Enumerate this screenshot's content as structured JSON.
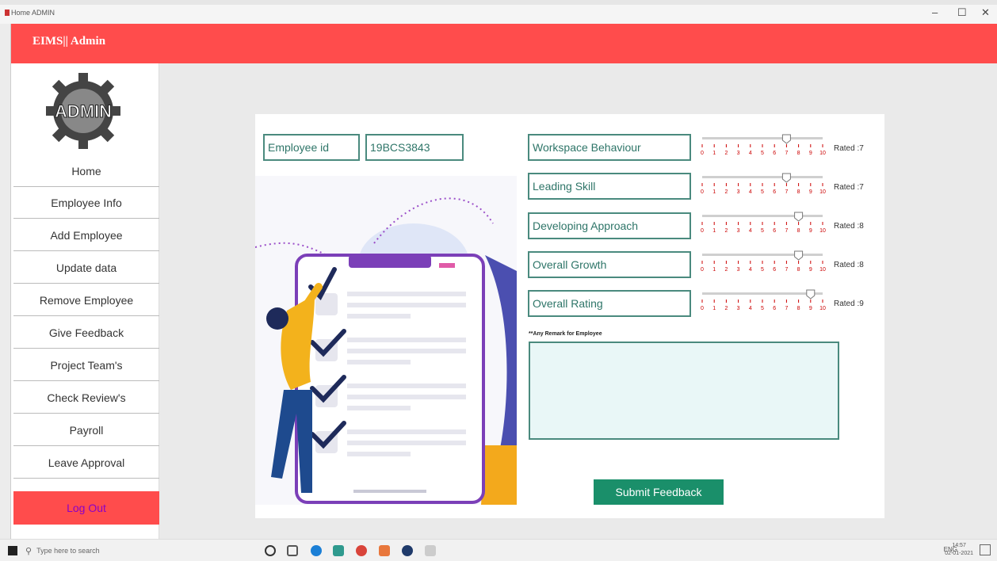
{
  "window": {
    "title": "Home ADMIN",
    "minimize": "–",
    "maximize": "☐",
    "close": "✕"
  },
  "header": {
    "brand": "EIMS|| Admin"
  },
  "sidebar": {
    "logo_text": "ADMIN",
    "items": [
      {
        "label": "Home"
      },
      {
        "label": "Employee Info"
      },
      {
        "label": "Add Employee"
      },
      {
        "label": "Update data"
      },
      {
        "label": "Remove Employee"
      },
      {
        "label": "Give Feedback"
      },
      {
        "label": "Project Team's"
      },
      {
        "label": "Check Review's"
      },
      {
        "label": "Payroll"
      },
      {
        "label": "Leave Approval"
      }
    ],
    "logout": "Log Out"
  },
  "form": {
    "employee_id_label": "Employee id",
    "employee_id_value": "19BCS3843",
    "ratings": [
      {
        "label": "Workspace Behaviour",
        "value": 7,
        "rated": "Rated :7"
      },
      {
        "label": "Leading Skill",
        "value": 7,
        "rated": "Rated :7"
      },
      {
        "label": "Developing Approach",
        "value": 8,
        "rated": "Rated :8"
      },
      {
        "label": "Overall Growth",
        "value": 8,
        "rated": "Rated :8"
      },
      {
        "label": "Overall Rating",
        "value": 9,
        "rated": "Rated :9"
      }
    ],
    "slider_ticks": [
      "0",
      "1",
      "2",
      "3",
      "4",
      "5",
      "6",
      "7",
      "8",
      "9",
      "10"
    ],
    "remark_label": "**Any Remark for Employee",
    "remark_value": "",
    "submit_label": "Submit Feedback"
  },
  "taskbar": {
    "search_placeholder": "Type here to search",
    "tray_text": "ENG",
    "time": "14:57",
    "date": "02-01-2021"
  },
  "colors": {
    "accent": "#ff4c4c",
    "teal": "#4a8a7e",
    "submit": "#1a8f6a",
    "logout_text": "#8b00c8"
  }
}
